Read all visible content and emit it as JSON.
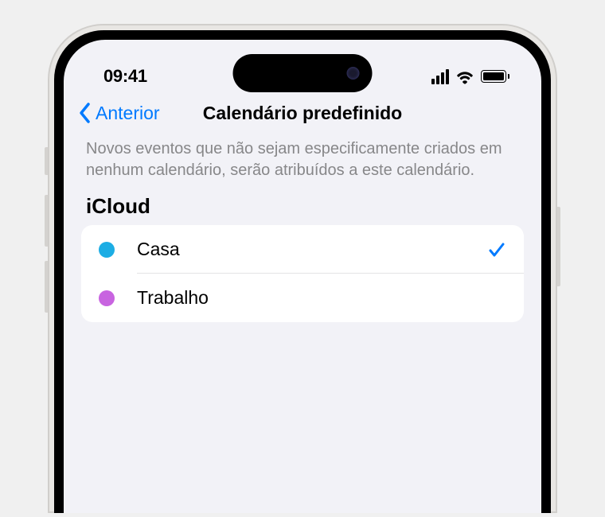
{
  "status_bar": {
    "time": "09:41"
  },
  "nav": {
    "back_label": "Anterior",
    "title": "Calendário predefinido"
  },
  "description": "Novos eventos que não sejam especificamente criados em nenhum calendário, serão atribuídos a este calendário.",
  "section": {
    "title": "iCloud"
  },
  "calendars": [
    {
      "label": "Casa",
      "color": "#1CADE4",
      "selected": true
    },
    {
      "label": "Trabalho",
      "color": "#C864E0",
      "selected": false
    }
  ]
}
